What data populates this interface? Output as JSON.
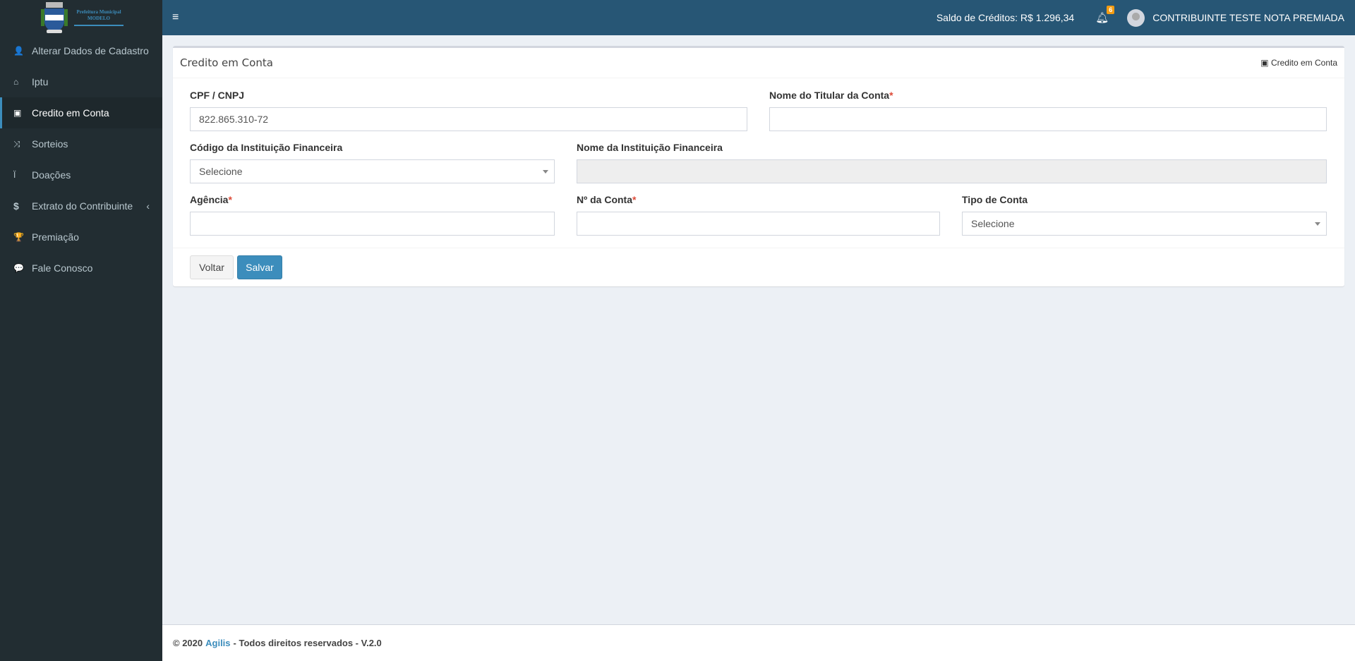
{
  "logo": {
    "line1": "Prefeitura Municipal",
    "line2": "MODELO"
  },
  "sidebar": {
    "items": [
      {
        "label": "Alterar Dados de Cadastro",
        "icon": "user-icon",
        "glyph": "👤"
      },
      {
        "label": "Iptu",
        "icon": "home-icon",
        "glyph": "⌂"
      },
      {
        "label": "Credito em Conta",
        "icon": "money-icon",
        "glyph": "▣",
        "active": true
      },
      {
        "label": "Sorteios",
        "icon": "random-icon",
        "glyph": "⤨"
      },
      {
        "label": "Doações",
        "icon": "child-icon",
        "glyph": "Ϊ"
      },
      {
        "label": "Extrato do Contribuinte",
        "icon": "dollar-icon",
        "glyph": "$",
        "chevron": "‹"
      },
      {
        "label": "Premiação",
        "icon": "trophy-icon",
        "glyph": "🏆"
      },
      {
        "label": "Fale Conosco",
        "icon": "comments-icon",
        "glyph": "💬"
      }
    ]
  },
  "header": {
    "menu_glyph": "≡",
    "saldo": "Saldo de Créditos: R$ 1.296,34",
    "notifications": "6",
    "user": "CONTRIBUINTE TESTE NOTA PREMIADA"
  },
  "page": {
    "title": "Credito em Conta",
    "breadcrumb": "Credito em Conta"
  },
  "form": {
    "cpf": {
      "label": "CPF / CNPJ",
      "value": "822.865.310-72"
    },
    "titular": {
      "label": "Nome do Titular da Conta",
      "required": "*",
      "value": ""
    },
    "codigo": {
      "label": "Código da Instituição Financeira",
      "value": "Selecione"
    },
    "nome_inst": {
      "label": "Nome da Instituição Financeira",
      "value": ""
    },
    "agencia": {
      "label": "Agência",
      "required": "*",
      "value": ""
    },
    "conta": {
      "label": "Nº da Conta",
      "required": "*",
      "value": ""
    },
    "tipo": {
      "label": "Tipo de Conta",
      "value": "Selecione"
    }
  },
  "buttons": {
    "back": "Voltar",
    "save": "Salvar"
  },
  "footer": {
    "prefix": "© 2020",
    "brand": "Agilis",
    "suffix": "- Todos direitos reservados - V.2.0"
  },
  "colors": {
    "header": "#275675",
    "sidebar": "#222d32",
    "primary": "#3c8dbc",
    "required": "#dd4b39",
    "badge": "#f39c12"
  }
}
